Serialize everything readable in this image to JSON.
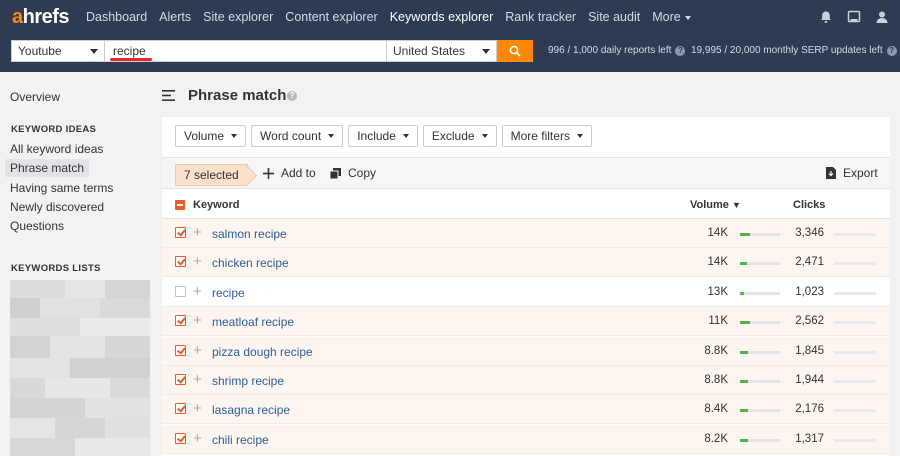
{
  "brand": {
    "logo_a": "a",
    "logo_rest": "hrefs",
    "accent": "#ff8800",
    "nav_bg": "#2f3b52"
  },
  "nav": {
    "items": [
      {
        "label": "Dashboard"
      },
      {
        "label": "Alerts"
      },
      {
        "label": "Site explorer"
      },
      {
        "label": "Content explorer"
      },
      {
        "label": "Keywords explorer",
        "active": true
      },
      {
        "label": "Rank tracker"
      },
      {
        "label": "Site audit"
      },
      {
        "label": "More"
      }
    ],
    "icons": [
      "bell-icon",
      "monitor-icon",
      "user-icon"
    ]
  },
  "search": {
    "source": "Youtube",
    "query": "recipe",
    "country": "United States",
    "daily_reports": "996 / 1,000 daily reports left",
    "serp_updates": "19,995 / 20,000 monthly SERP updates left"
  },
  "sidebar": {
    "overview": "Overview",
    "keyword_ideas_heading": "KEYWORD IDEAS",
    "ideas": [
      {
        "label": "All keyword ideas"
      },
      {
        "label": "Phrase match",
        "active": true
      },
      {
        "label": "Having same terms"
      },
      {
        "label": "Newly discovered"
      },
      {
        "label": "Questions"
      }
    ],
    "lists_heading": "KEYWORDS LISTS"
  },
  "main": {
    "title": "Phrase match",
    "filters": [
      "Volume",
      "Word count",
      "Include",
      "Exclude",
      "More filters"
    ],
    "selected_label": "7 selected",
    "add_to": "Add to",
    "copy": "Copy",
    "export": "Export",
    "columns": {
      "keyword": "Keyword",
      "volume": "Volume",
      "clicks": "Clicks"
    }
  },
  "table": {
    "rows": [
      {
        "keyword": "salmon recipe",
        "volume": "14K",
        "volume_ratio": 0.25,
        "clicks": "3,346",
        "selected": true
      },
      {
        "keyword": "chicken recipe",
        "volume": "14K",
        "volume_ratio": 0.18,
        "clicks": "2,471",
        "selected": true
      },
      {
        "keyword": "recipe",
        "volume": "13K",
        "volume_ratio": 0.1,
        "clicks": "1,023",
        "selected": false
      },
      {
        "keyword": "meatloaf recipe",
        "volume": "11K",
        "volume_ratio": 0.25,
        "clicks": "2,562",
        "selected": true
      },
      {
        "keyword": "pizza dough recipe",
        "volume": "8.8K",
        "volume_ratio": 0.2,
        "clicks": "1,845",
        "selected": true
      },
      {
        "keyword": "shrimp recipe",
        "volume": "8.8K",
        "volume_ratio": 0.2,
        "clicks": "1,944",
        "selected": true
      },
      {
        "keyword": "lasagna recipe",
        "volume": "8.4K",
        "volume_ratio": 0.2,
        "clicks": "2,176",
        "selected": true
      },
      {
        "keyword": "chili recipe",
        "volume": "8.2K",
        "volume_ratio": 0.2,
        "clicks": "1,317",
        "selected": true
      }
    ]
  }
}
